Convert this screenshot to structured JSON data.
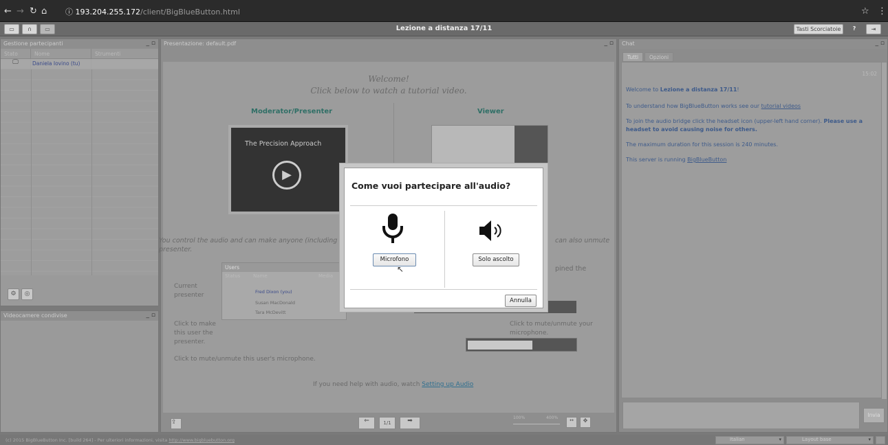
{
  "browser": {
    "host": "193.204.255.172",
    "path": "/client/BigBlueButton.html"
  },
  "toolbar": {
    "title": "Lezione a distanza 17/11",
    "shortcuts": "Tasti Scorciatoie",
    "help": "?"
  },
  "participants": {
    "title": "Gestione partecipanti",
    "cols": [
      "Stato",
      "Nome",
      "Strumenti"
    ],
    "user": "Daniela Iovino (tu)"
  },
  "webcams": {
    "title": "Videocamere condivise"
  },
  "presentation": {
    "title": "Presentazione: default.pdf",
    "welcome": "Welcome!",
    "click": "Click below to watch a tutorial video.",
    "moderator": "Moderator/Presenter",
    "viewer": "Viewer",
    "video_title": "The Precision Approach",
    "control_text": "You control the audio and can make anyone (including",
    "control_text2": "presenter.",
    "can_unmute": "can also unmute",
    "joined": "pined the",
    "users_hdr": "Users",
    "users_cols": [
      "Status",
      "Name",
      "Media"
    ],
    "users": [
      "Fred Dixon (you)",
      "Susan MacDonald",
      "Tara McDevitt"
    ],
    "current": "Current",
    "presenter": "presenter",
    "make1": "Click to make",
    "make2": "this user the",
    "make3": "presenter.",
    "mute_user": "Click to mute/unmute this user's microphone.",
    "mute_your1": "Click to mute/unmute your",
    "mute_your2": "microphone.",
    "help_audio": "If you need help with audio, watch ",
    "setting_up": "Setting up Audio",
    "page": "1/1",
    "zoom1": "100%",
    "zoom2": "400%"
  },
  "chat": {
    "title": "Chat",
    "tabs": [
      "Tutti",
      "Opzioni"
    ],
    "time": "15:02",
    "welcome_pre": "Welcome to ",
    "welcome_name": "Lezione a distanza 17/11",
    "welcome_post": "!",
    "understand": "To understand how BigBlueButton works see our ",
    "tutorial": "tutorial videos",
    "join1": "To join the audio bridge click the headset icon (upper-left hand corner). ",
    "join_bold": "Please use a headset to avoid causing noise for others.",
    "duration": "The maximum duration for this session is 240 minutes.",
    "server": "This server is running ",
    "bbb": "BigBlueButton",
    "send": "Invia"
  },
  "modal": {
    "title": "Come vuoi partecipare all'audio?",
    "mic": "Microfono",
    "listen": "Solo ascolto",
    "cancel": "Annulla"
  },
  "footer": {
    "copyright": "(c) 2015 BigBlueButton Inc. [build 264] - Per ulteriori informazioni, visita ",
    "link": "http://www.bigbluebutton.org",
    "lang": "Italian",
    "layout": "Layout base"
  }
}
